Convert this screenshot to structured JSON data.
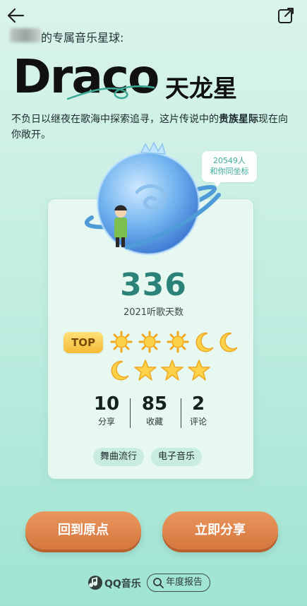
{
  "header": {
    "subtitle": "的专属音乐星球:",
    "constellation_en": "Draco",
    "constellation_cn": "天龙星"
  },
  "description": {
    "text_before": "不负日以继夜在歌海中探索追寻，这片传说中的",
    "highlight": "贵族星际",
    "text_after": "现在向你敞开。"
  },
  "bubble": {
    "line1": "20549人",
    "line2": "和你同坐标"
  },
  "stats": {
    "days_value": "336",
    "days_label": "2021听歌天数",
    "badge": "TOP",
    "rating_icons": [
      "sun-icon",
      "sun-icon",
      "sun-icon",
      "moon-icon",
      "moon-icon",
      "moon-icon",
      "star-icon",
      "star-icon",
      "star-icon"
    ],
    "share_value": "10",
    "share_label": "分享",
    "fav_value": "85",
    "fav_label": "收藏",
    "comment_value": "2",
    "comment_label": "评论"
  },
  "tags": [
    "舞曲流行",
    "电子音乐"
  ],
  "buttons": {
    "back_origin": "回到原点",
    "share_now": "立即分享"
  },
  "footer": {
    "brand": "QQ音乐",
    "report": "年度报告"
  },
  "colors": {
    "accent": "#2a8279",
    "button": "#e08650",
    "background": "#c7efe3"
  }
}
